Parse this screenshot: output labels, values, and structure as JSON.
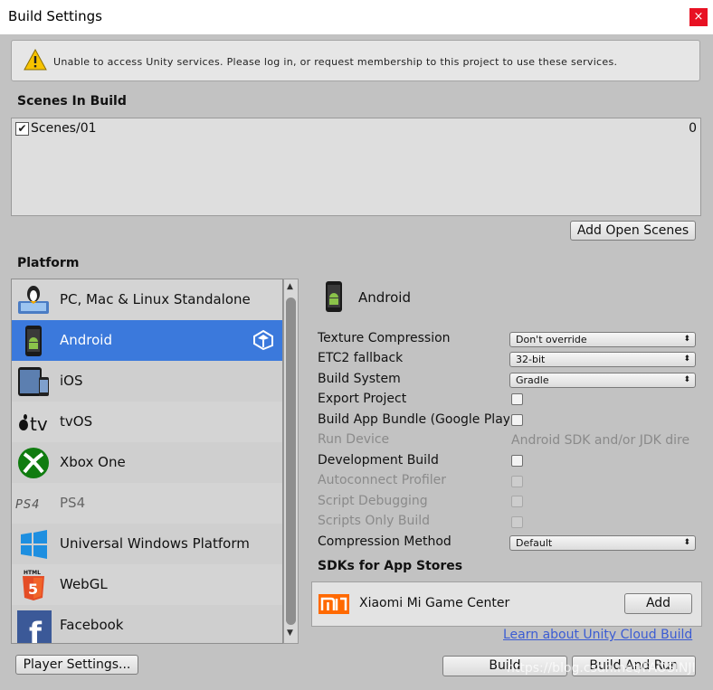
{
  "window": {
    "title": "Build Settings",
    "close_glyph": "×"
  },
  "warning": {
    "text": "Unable to access Unity services. Please log in, or request membership to this project to use these services.",
    "icon": "warning-icon"
  },
  "scenes": {
    "heading": "Scenes In Build",
    "items": [
      {
        "name": "Scenes/01",
        "index": "0",
        "checked": true
      }
    ],
    "add_open_scenes": "Add Open Scenes"
  },
  "platform": {
    "heading": "Platform",
    "items": [
      {
        "label": "PC, Mac & Linux Standalone",
        "icon": "standalone-icon"
      },
      {
        "label": "Android",
        "icon": "android-icon",
        "selected": true
      },
      {
        "label": "iOS",
        "icon": "ios-icon"
      },
      {
        "label": "tvOS",
        "icon": "tvos-icon"
      },
      {
        "label": "Xbox One",
        "icon": "xbox-icon"
      },
      {
        "label": "PS4",
        "icon": "ps4-icon"
      },
      {
        "label": "Universal Windows Platform",
        "icon": "windows-icon"
      },
      {
        "label": "WebGL",
        "icon": "html5-icon"
      },
      {
        "label": "Facebook",
        "icon": "facebook-icon"
      }
    ],
    "selected_name": "Android"
  },
  "options": {
    "texture_compression": {
      "label": "Texture Compression",
      "value": "Don't override"
    },
    "etc2_fallback": {
      "label": "ETC2 fallback",
      "value": "32-bit"
    },
    "build_system": {
      "label": "Build System",
      "value": "Gradle"
    },
    "export_project": {
      "label": "Export Project"
    },
    "build_app_bundle": {
      "label": "Build App Bundle (Google Play"
    },
    "run_device": {
      "label": "Run Device",
      "value": "Android SDK and/or JDK dire"
    },
    "development_build": {
      "label": "Development Build"
    },
    "autoconnect_profiler": {
      "label": "Autoconnect Profiler"
    },
    "script_debugging": {
      "label": "Script Debugging"
    },
    "scripts_only_build": {
      "label": "Scripts Only Build"
    },
    "compression_method": {
      "label": "Compression Method",
      "value": "Default"
    }
  },
  "sdks": {
    "heading": "SDKs for App Stores",
    "items": [
      {
        "name": "Xiaomi Mi Game Center",
        "button": "Add"
      }
    ],
    "cloud_link": "Learn about Unity Cloud Build"
  },
  "footer": {
    "player_settings": "Player Settings...",
    "build": "Build",
    "build_and_run": "Build And Run"
  },
  "watermark": "https://blog.csdn.net/FAOSINJI",
  "colors": {
    "selection": "#3b79dc",
    "link": "#3b5cd3",
    "close": "#e81123"
  }
}
